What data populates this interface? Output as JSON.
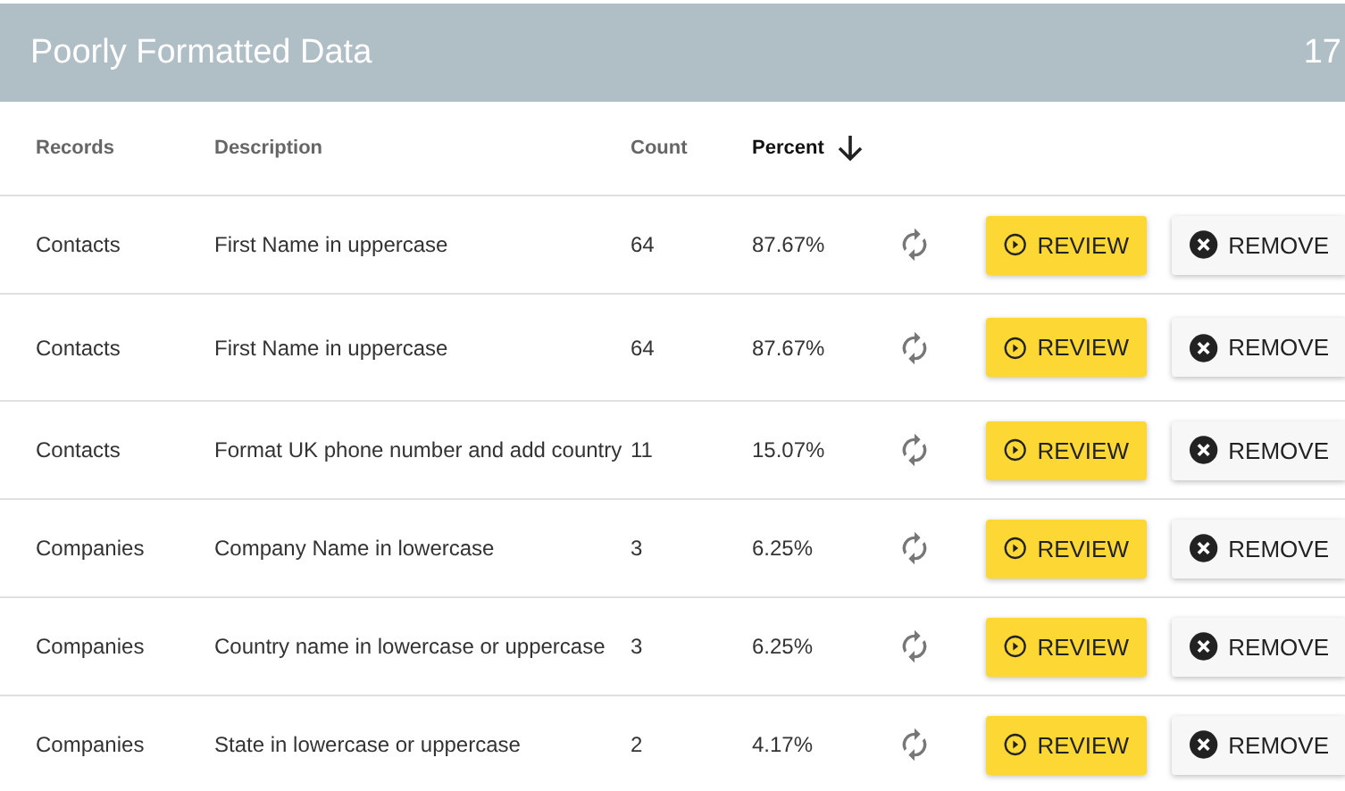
{
  "header": {
    "title": "Poorly Formatted Data",
    "count": "17"
  },
  "columns": [
    {
      "label": "Records",
      "sorted": false
    },
    {
      "label": "Description",
      "sorted": false
    },
    {
      "label": "Count",
      "sorted": false
    },
    {
      "label": "Percent",
      "sorted": true
    }
  ],
  "rows": [
    {
      "records": "Contacts",
      "description": "First Name in uppercase",
      "count": "64",
      "percent": "87.67%",
      "review": "REVIEW",
      "remove": "REMOVE"
    },
    {
      "records": "Contacts",
      "description": "First Name in uppercase",
      "count": "64",
      "percent": "87.67%",
      "review": "REVIEW",
      "remove": "REMOVE"
    },
    {
      "records": "Contacts",
      "description": "Format UK phone number and add country",
      "count": "11",
      "percent": "15.07%",
      "review": "REVIEW",
      "remove": "REMOVE"
    },
    {
      "records": "Companies",
      "description": "Company Name in lowercase",
      "count": "3",
      "percent": "6.25%",
      "review": "REVIEW",
      "remove": "REMOVE"
    },
    {
      "records": "Companies",
      "description": "Country name in lowercase or uppercase",
      "count": "3",
      "percent": "6.25%",
      "review": "REVIEW",
      "remove": "REMOVE"
    },
    {
      "records": "Companies",
      "description": "State in lowercase or uppercase",
      "count": "2",
      "percent": "4.17%",
      "review": "REVIEW",
      "remove": "REMOVE"
    }
  ]
}
